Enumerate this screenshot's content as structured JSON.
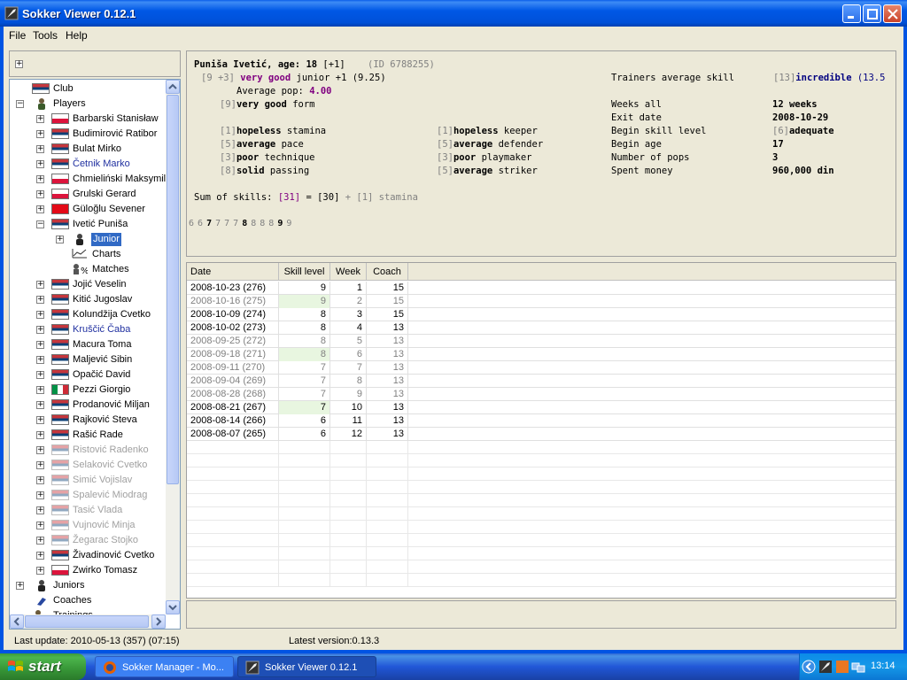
{
  "window": {
    "title": "Sokker Viewer 0.12.1"
  },
  "menu": [
    "File",
    "Tools",
    "Help"
  ],
  "tree": {
    "club": "Club",
    "players": "Players",
    "player_list": [
      {
        "name": "Barbarski Stanisław",
        "flag": "pl",
        "state": "normal"
      },
      {
        "name": "Budimirović Ratibor",
        "flag": "rs",
        "state": "normal"
      },
      {
        "name": "Bulat Mirko",
        "flag": "rs",
        "state": "normal"
      },
      {
        "name": "Četnik Marko",
        "flag": "rs",
        "state": "blue"
      },
      {
        "name": "Chmieliński Maksymili",
        "flag": "pl",
        "state": "normal"
      },
      {
        "name": "Grulski Gerard",
        "flag": "pl",
        "state": "normal"
      },
      {
        "name": "Güloğlu Sevener",
        "flag": "tr",
        "state": "normal"
      },
      {
        "name": "Ivetić Puniša",
        "flag": "rs",
        "state": "normal",
        "expanded": true
      }
    ],
    "sub_items": {
      "junior": "Junior",
      "charts": "Charts",
      "matches": "Matches"
    },
    "player_list_2": [
      {
        "name": "Jojić Veselin",
        "flag": "rs",
        "state": "normal"
      },
      {
        "name": "Kitić Jugoslav",
        "flag": "rs",
        "state": "normal"
      },
      {
        "name": "Kolundžija Cvetko",
        "flag": "rs",
        "state": "normal"
      },
      {
        "name": "Kruščić Čaba",
        "flag": "rs",
        "state": "blue"
      },
      {
        "name": "Macura Toma",
        "flag": "rs",
        "state": "normal"
      },
      {
        "name": "Maljević Sibin",
        "flag": "rs",
        "state": "normal"
      },
      {
        "name": "Opačić David",
        "flag": "rs",
        "state": "normal"
      },
      {
        "name": "Pezzi Giorgio",
        "flag": "it",
        "state": "normal"
      },
      {
        "name": "Prodanović Miljan",
        "flag": "rs",
        "state": "normal"
      },
      {
        "name": "Rajković Steva",
        "flag": "rs",
        "state": "normal"
      },
      {
        "name": "Rašić Rade",
        "flag": "rs",
        "state": "normal"
      },
      {
        "name": "Ristović Radenko",
        "flag": "rs",
        "state": "dim"
      },
      {
        "name": "Selaković Cvetko",
        "flag": "rs",
        "state": "dim"
      },
      {
        "name": "Simić Vojislav",
        "flag": "rs",
        "state": "dim"
      },
      {
        "name": "Spalević Miodrag",
        "flag": "rs",
        "state": "dim"
      },
      {
        "name": "Tasić Vlada",
        "flag": "rs",
        "state": "dim"
      },
      {
        "name": "Vujnović Minja",
        "flag": "rs",
        "state": "dim"
      },
      {
        "name": "Žegarac Stojko",
        "flag": "rs",
        "state": "dim"
      },
      {
        "name": "Živadinović Cvetko",
        "flag": "rs",
        "state": "normal"
      },
      {
        "name": "Zwirko Tomasz",
        "flag": "pl",
        "state": "normal"
      }
    ],
    "juniors": "Juniors",
    "coaches": "Coaches",
    "trainings": "Trainings"
  },
  "info": {
    "name": "Puniša Ivetić, age:",
    "age": "18",
    "age_delta": "[+1]",
    "id": "(ID 6788255)",
    "skill_bracket": "[9 +3]",
    "skill_word": "very good",
    "skill_rest": "junior +1 (9.25)",
    "avg_pop_label": "Average pop:",
    "avg_pop_value": "4.00",
    "form_bracket": "[9]",
    "form_word": "very good",
    "form_rest": "form",
    "skills_left": [
      {
        "b": "[1]",
        "w": "hopeless",
        "s": "stamina"
      },
      {
        "b": "[5]",
        "w": "average",
        "s": "pace"
      },
      {
        "b": "[3]",
        "w": "poor",
        "s": "technique"
      },
      {
        "b": "[8]",
        "w": "solid",
        "s": "passing"
      }
    ],
    "skills_mid": [
      {
        "b": "[1]",
        "w": "hopeless",
        "s": "keeper"
      },
      {
        "b": "[5]",
        "w": "average",
        "s": "defender"
      },
      {
        "b": "[3]",
        "w": "poor",
        "s": "playmaker"
      },
      {
        "b": "[5]",
        "w": "average",
        "s": "striker"
      }
    ],
    "trainers_label": "Trainers average skill",
    "trainers_bracket": "[13]",
    "trainers_word": "incredible",
    "trainers_rest": "(13.5",
    "stats": [
      {
        "label": "Weeks all",
        "value": "12 weeks"
      },
      {
        "label": "Exit date",
        "value": "2008-10-29"
      },
      {
        "label": "Begin skill level",
        "bracket": "[6]",
        "value": "adequate"
      },
      {
        "label": "Begin age",
        "value": "17"
      },
      {
        "label": "Number of pops",
        "value": "3"
      },
      {
        "label": "Spent money",
        "value": "960,000 din"
      }
    ],
    "sum_label": "Sum of skills:",
    "sum_bracket": "[31]",
    "sum_rest": "= [30]",
    "sum_plus": "+ [1] stamina",
    "history": [
      {
        "v": "6",
        "s": "n"
      },
      {
        "v": "6",
        "s": "n"
      },
      {
        "v": "7",
        "s": "b"
      },
      {
        "v": "7",
        "s": "n"
      },
      {
        "v": "7",
        "s": "n"
      },
      {
        "v": "7",
        "s": "n"
      },
      {
        "v": "8",
        "s": "b"
      },
      {
        "v": "8",
        "s": "n"
      },
      {
        "v": "8",
        "s": "n"
      },
      {
        "v": "8",
        "s": "n"
      },
      {
        "v": "9",
        "s": "b"
      },
      {
        "v": "9",
        "s": "n"
      }
    ]
  },
  "table": {
    "headers": [
      "Date",
      "Skill level",
      "Week",
      "Coach"
    ],
    "rows": [
      {
        "date": "2008-10-23 (276)",
        "skill": "9",
        "week": "1",
        "coach": "15",
        "hl": false,
        "dim": false
      },
      {
        "date": "2008-10-16 (275)",
        "skill": "9",
        "week": "2",
        "coach": "15",
        "hl": true,
        "dim": true
      },
      {
        "date": "2008-10-09 (274)",
        "skill": "8",
        "week": "3",
        "coach": "15",
        "hl": false,
        "dim": false
      },
      {
        "date": "2008-10-02 (273)",
        "skill": "8",
        "week": "4",
        "coach": "13",
        "hl": false,
        "dim": false
      },
      {
        "date": "2008-09-25 (272)",
        "skill": "8",
        "week": "5",
        "coach": "13",
        "hl": false,
        "dim": true
      },
      {
        "date": "2008-09-18 (271)",
        "skill": "8",
        "week": "6",
        "coach": "13",
        "hl": true,
        "dim": true
      },
      {
        "date": "2008-09-11 (270)",
        "skill": "7",
        "week": "7",
        "coach": "13",
        "hl": false,
        "dim": true
      },
      {
        "date": "2008-09-04 (269)",
        "skill": "7",
        "week": "8",
        "coach": "13",
        "hl": false,
        "dim": true
      },
      {
        "date": "2008-08-28 (268)",
        "skill": "7",
        "week": "9",
        "coach": "13",
        "hl": false,
        "dim": true
      },
      {
        "date": "2008-08-21 (267)",
        "skill": "7",
        "week": "10",
        "coach": "13",
        "hl": true,
        "dim": false
      },
      {
        "date": "2008-08-14 (266)",
        "skill": "6",
        "week": "11",
        "coach": "13",
        "hl": false,
        "dim": false
      },
      {
        "date": "2008-08-07 (265)",
        "skill": "6",
        "week": "12",
        "coach": "13",
        "hl": false,
        "dim": false
      }
    ]
  },
  "status": {
    "last_update": "Last update: 2010-05-13 (357) (07:15)",
    "latest_version": "Latest version:0.13.3"
  },
  "taskbar": {
    "start": "start",
    "tasks": [
      "Sokker Manager - Mo...",
      "Sokker Viewer 0.12.1"
    ],
    "clock": "13:14"
  }
}
